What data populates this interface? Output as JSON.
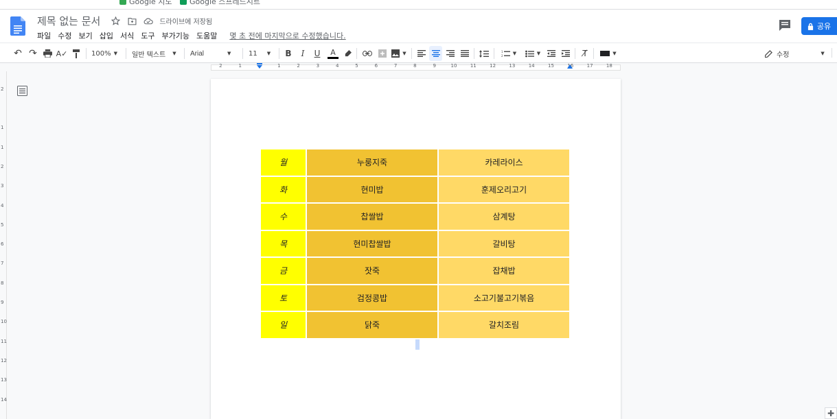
{
  "app": {
    "doc_title": "제목 없는 문서",
    "saved_status": "드라이브에 저장됨",
    "last_edit": "몇 초 전에 마지막으로 수정했습니다.",
    "share_label": "공유",
    "menus": [
      "파일",
      "수정",
      "보기",
      "삽입",
      "서식",
      "도구",
      "부가기능",
      "도움말"
    ]
  },
  "bookmarks": [
    "Google 지도",
    "Google 스프레드시트"
  ],
  "toolbar": {
    "zoom": "100%",
    "style": "일반 텍스트",
    "font": "Arial",
    "font_size": "11",
    "mode": "수정"
  },
  "ruler": {
    "labels": [
      "2",
      "1",
      "1",
      "2",
      "3",
      "4",
      "5",
      "6",
      "7",
      "8",
      "9",
      "10",
      "11",
      "12",
      "13",
      "14",
      "15",
      "16",
      "17",
      "18"
    ],
    "vlabels": [
      "2",
      "1",
      "1",
      "2",
      "3",
      "4",
      "5",
      "6",
      "7",
      "8",
      "9",
      "10",
      "11",
      "12",
      "13",
      "14"
    ]
  },
  "table": {
    "rows": [
      {
        "day": "월",
        "meal1": "누룽지죽",
        "meal2": "카레라이스"
      },
      {
        "day": "화",
        "meal1": "현미밥",
        "meal2": "훈제오리고기"
      },
      {
        "day": "수",
        "meal1": "찹쌀밥",
        "meal2": "삼계탕"
      },
      {
        "day": "목",
        "meal1": "현미찹쌀밥",
        "meal2": "갈비탕"
      },
      {
        "day": "금",
        "meal1": "잣죽",
        "meal2": "잡채밥"
      },
      {
        "day": "토",
        "meal1": "검정콩밥",
        "meal2": "소고기불고기볶음"
      },
      {
        "day": "일",
        "meal1": "닭죽",
        "meal2": "갈치조림"
      }
    ]
  },
  "colors": {
    "day_cell": "#ffff00",
    "meal1_cell": "#f1c232",
    "meal2_cell": "#ffd966",
    "accent": "#1a73e8"
  }
}
